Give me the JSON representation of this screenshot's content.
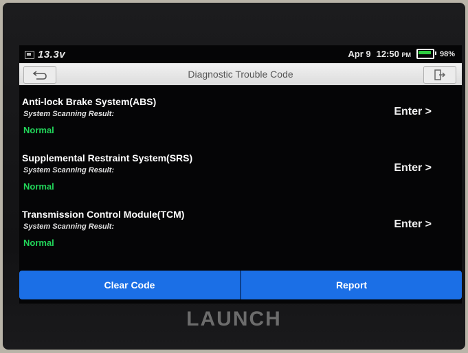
{
  "status_bar": {
    "voltage": "13.3v",
    "date": "Apr 9",
    "time": "12:50",
    "ampm": "PM",
    "battery_percent": "98%"
  },
  "title_bar": {
    "title": "Diagnostic Trouble Code"
  },
  "systems": [
    {
      "name": "Anti-lock Brake System(ABS)",
      "scan_label": "System Scanning Result:",
      "result": "Normal",
      "action": "Enter >"
    },
    {
      "name": "Supplemental Restraint System(SRS)",
      "scan_label": "System Scanning Result:",
      "result": "Normal",
      "action": "Enter >"
    },
    {
      "name": "Transmission Control Module(TCM)",
      "scan_label": "System Scanning Result:",
      "result": "Normal",
      "action": "Enter >"
    }
  ],
  "footer": {
    "clear_code": "Clear Code",
    "report": "Report"
  },
  "device": {
    "brand": "LAUNCH"
  },
  "colors": {
    "accent_blue": "#1b6fe6",
    "normal_green": "#22d65a",
    "battery_green": "#2ecc40"
  },
  "icons": [
    "battery-icon",
    "back-arrow-icon",
    "exit-icon",
    "battery-level-icon"
  ]
}
